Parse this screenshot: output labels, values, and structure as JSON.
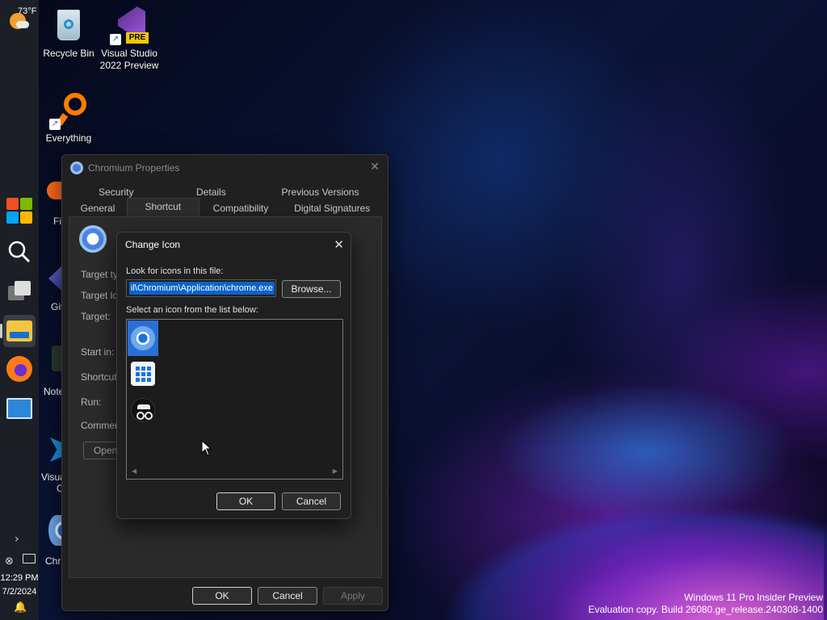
{
  "weather": {
    "temp": "73°F"
  },
  "desktop_icons": [
    {
      "label": "Recycle Bin"
    },
    {
      "label": "Visual Studio 2022 Preview",
      "badge": "PRE"
    },
    {
      "label": "Everything"
    }
  ],
  "partial_desktop_labels": [
    "Fi",
    "Git",
    "Note",
    "Visua",
    "C",
    "Chr"
  ],
  "properties": {
    "title": "Chromium Properties",
    "tabs_row1": [
      "Security",
      "Details",
      "Previous Versions"
    ],
    "tabs_row2": [
      "General",
      "Shortcut",
      "Compatibility",
      "Digital Signatures"
    ],
    "selected_tab": "Shortcut",
    "labels": {
      "target_type": "Target typ",
      "target_location": "Target loc",
      "target": "Target:",
      "start_in": "Start in:",
      "shortcut_key": "Shortcut k",
      "run": "Run:",
      "comment": "Comment:"
    },
    "open_file_btn": "Open",
    "buttons": {
      "ok": "OK",
      "cancel": "Cancel",
      "apply": "Apply"
    }
  },
  "change_icon": {
    "title": "Change Icon",
    "look_label": "Look for icons in this file:",
    "path_value": "il\\Chromium\\Application\\chrome.exe",
    "browse": "Browse...",
    "select_label": "Select an icon from the list below:",
    "icons": [
      "chrome-icon",
      "app-grid-icon",
      "incognito-icon"
    ],
    "selected_index": 0,
    "ok": "OK",
    "cancel": "Cancel"
  },
  "tray": {
    "time": "12:29 PM",
    "date": "7/2/2024"
  },
  "watermark": {
    "line1": "Windows 11 Pro Insider Preview",
    "line2": "Evaluation copy. Build 26080.ge_release.240308-1400"
  }
}
